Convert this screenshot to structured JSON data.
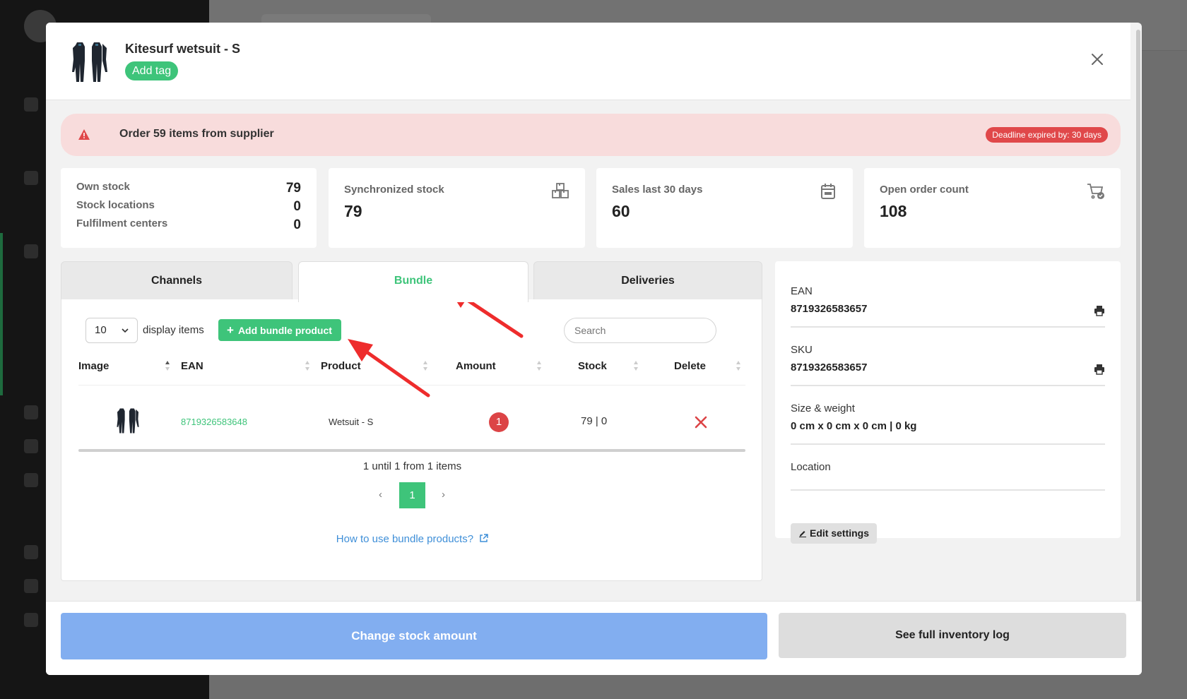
{
  "product": {
    "title": "Kitesurf wetsuit - S",
    "add_tag_label": "Add tag"
  },
  "alert": {
    "message": "Order 59 items from supplier",
    "badge": "Deadline expired by: 30 days"
  },
  "stock": {
    "rows": [
      {
        "label": "Own stock",
        "value": "79"
      },
      {
        "label": "Stock locations",
        "value": "0"
      },
      {
        "label": "Fulfilment centers",
        "value": "0"
      }
    ]
  },
  "stats": [
    {
      "label": "Synchronized stock",
      "value": "79",
      "icon": "boxes-icon"
    },
    {
      "label": "Sales last 30 days",
      "value": "60",
      "icon": "calendar-icon"
    },
    {
      "label": "Open order count",
      "value": "108",
      "icon": "cart-check-icon"
    }
  ],
  "tabs": [
    {
      "label": "Channels",
      "active": false
    },
    {
      "label": "Bundle",
      "active": true
    },
    {
      "label": "Deliveries",
      "active": false
    }
  ],
  "bundle": {
    "page_size": "10",
    "display_items_label": "display items",
    "add_button_label": "Add bundle product",
    "search_placeholder": "Search",
    "columns": [
      "Image",
      "EAN",
      "Product",
      "Amount",
      "Stock",
      "Delete"
    ],
    "rows": [
      {
        "ean": "8719326583648",
        "product": "Wetsuit - S",
        "amount": "1",
        "stock": "79 | 0"
      }
    ],
    "pager_info": "1 until 1 from 1 items",
    "current_page": "1",
    "prev": "‹",
    "next": "›",
    "help_link": "How to use bundle products?"
  },
  "info": {
    "ean_label": "EAN",
    "ean_value": "8719326583657",
    "sku_label": "SKU",
    "sku_value": "8719326583657",
    "size_label": "Size & weight",
    "size_value": "0 cm x 0 cm x 0 cm | 0 kg",
    "location_label": "Location",
    "location_value": "",
    "edit_label": "Edit settings"
  },
  "footer": {
    "change_stock_label": "Change stock amount",
    "inventory_log_label": "See full inventory log"
  },
  "colors": {
    "accent_green": "#3ec47a",
    "alert_bg": "#f8dcdc",
    "danger_red": "#dc4446",
    "primary_blue": "#82aef0",
    "link_blue": "#3f8fd8"
  }
}
